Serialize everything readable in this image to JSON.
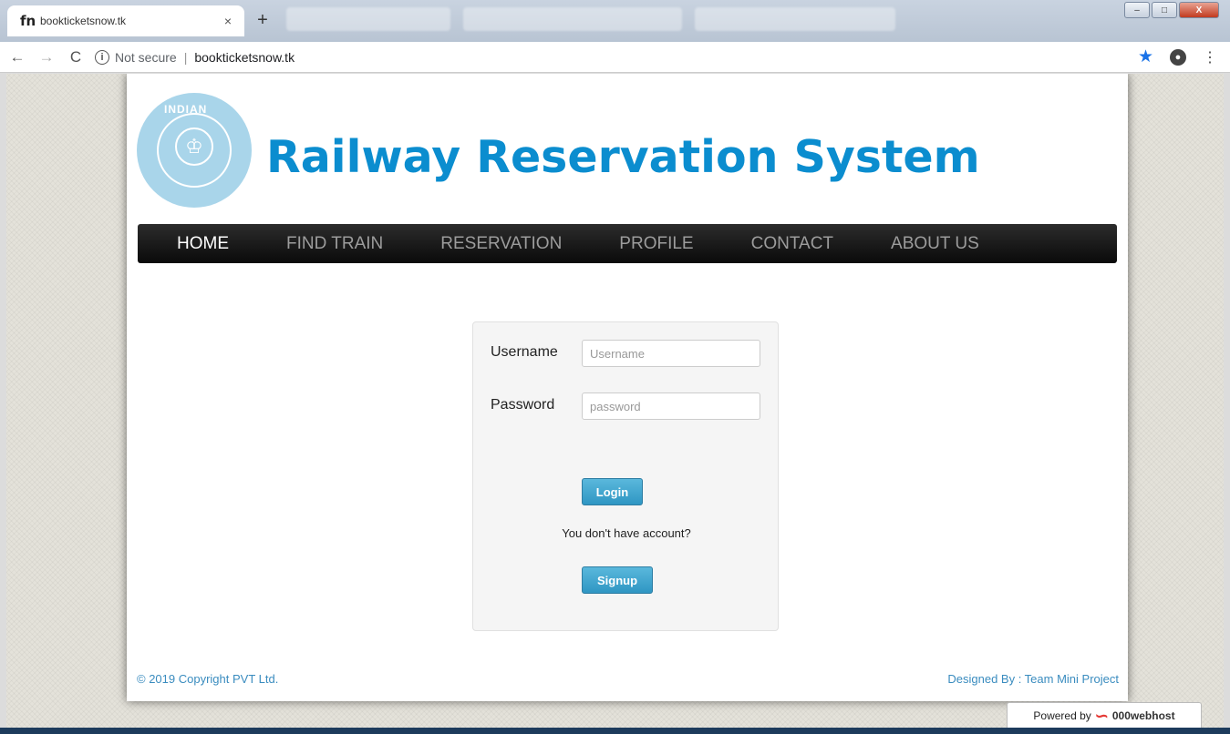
{
  "browser": {
    "tab_favicon": "fn",
    "tab_title": "bookticketsnow.tk",
    "tab_close": "×",
    "new_tab": "+",
    "nav_back": "←",
    "nav_forward": "→",
    "nav_reload": "C",
    "security_icon": "i",
    "security_text": "Not secure",
    "separator": "|",
    "url": "bookticketsnow.tk",
    "bookmark_icon": "★",
    "menu_icon": "⋮",
    "window_min": "–",
    "window_max": "□",
    "window_close": "X"
  },
  "header": {
    "logo_text": "INDIAN",
    "title": "Railway Reservation System"
  },
  "nav": {
    "items": [
      {
        "label": "HOME",
        "active": true
      },
      {
        "label": "FIND TRAIN",
        "active": false
      },
      {
        "label": "RESERVATION",
        "active": false
      },
      {
        "label": "PROFILE",
        "active": false
      },
      {
        "label": "CONTACT",
        "active": false
      },
      {
        "label": "ABOUT US",
        "active": false
      }
    ]
  },
  "login": {
    "username_label": "Username",
    "username_placeholder": "Username",
    "password_label": "Password",
    "password_placeholder": "password",
    "login_button": "Login",
    "prompt": "You don't have account?",
    "signup_button": "Signup"
  },
  "footer": {
    "copyright": "© 2019 Copyright PVT Ltd.",
    "designed_by": "Designed By : Team Mini Project"
  },
  "powered": {
    "label": "Powered by",
    "host": "000webhost"
  },
  "colors": {
    "brand_blue": "#0b8dcf",
    "button_blue": "#3aa3cf",
    "nav_bg": "#111111",
    "footer_link": "#3a8cbf"
  }
}
